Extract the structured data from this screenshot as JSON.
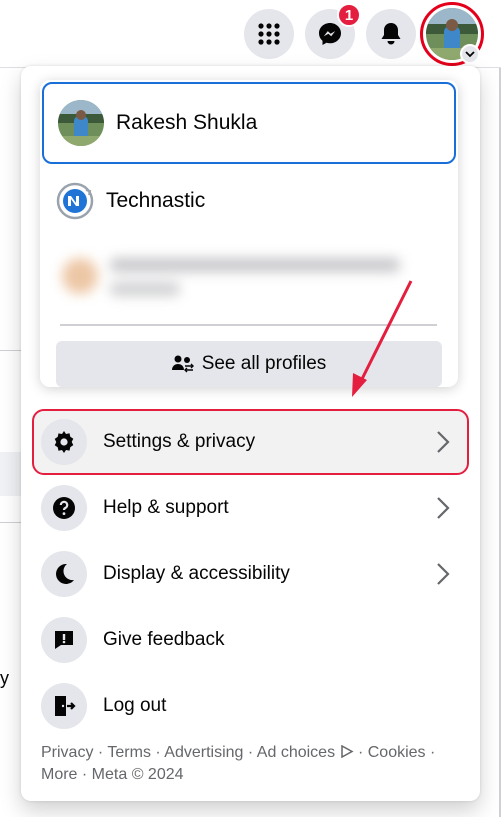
{
  "topbar": {
    "menu_icon": "grid-menu-icon",
    "messenger_icon": "messenger-icon",
    "messenger_badge": "1",
    "notifications_icon": "bell-icon",
    "account_icon": "chevron-down-icon"
  },
  "profiles": {
    "active_name": "Rakesh Shukla",
    "page_name": "Technastic",
    "see_all_label": "See all profiles"
  },
  "menu": {
    "items": [
      {
        "label": "Settings & privacy",
        "icon": "gear-icon",
        "chevron": true
      },
      {
        "label": "Help & support",
        "icon": "help-icon",
        "chevron": true
      },
      {
        "label": "Display & accessibility",
        "icon": "moon-icon",
        "chevron": true
      },
      {
        "label": "Give feedback",
        "icon": "feedback-icon",
        "chevron": false
      },
      {
        "label": "Log out",
        "icon": "logout-icon",
        "chevron": false
      }
    ]
  },
  "footer": {
    "privacy": "Privacy",
    "terms": "Terms",
    "advertising": "Advertising",
    "ad_choices": "Ad choices",
    "cookies": "Cookies",
    "more": "More",
    "meta": "Meta © 2024"
  },
  "colors": {
    "highlight_red": "#e41e3f",
    "active_border": "#1a6ed8",
    "badge_red": "#e41e3f"
  }
}
